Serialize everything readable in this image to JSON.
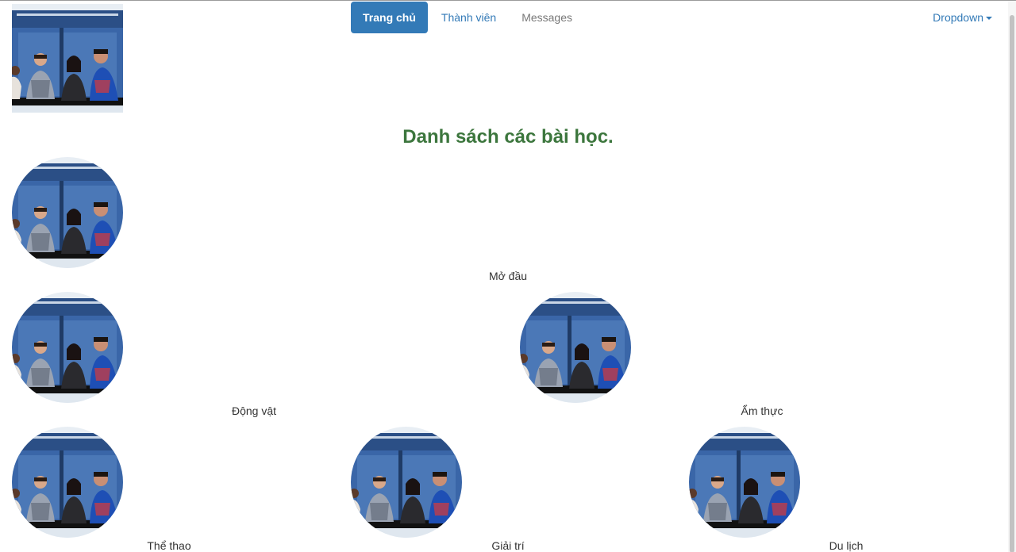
{
  "nav": {
    "items": [
      {
        "label": "Trang chủ",
        "state": "active"
      },
      {
        "label": "Thành viên",
        "state": "normal"
      },
      {
        "label": "Messages",
        "state": "muted"
      }
    ],
    "dropdown_label": "Dropdown"
  },
  "page_title": "Danh sách các bài học.",
  "lessons": [
    {
      "label": "Mở đầu"
    },
    {
      "label": "Động vật"
    },
    {
      "label": "Ẩm thực"
    },
    {
      "label": "Thể thao"
    },
    {
      "label": "Giải trí"
    },
    {
      "label": "Du lịch"
    }
  ],
  "colors": {
    "primary": "#337ab7",
    "title_green": "#3c763d",
    "muted_text": "#777777"
  },
  "icons": {
    "dropdown": "caret-down-icon"
  }
}
